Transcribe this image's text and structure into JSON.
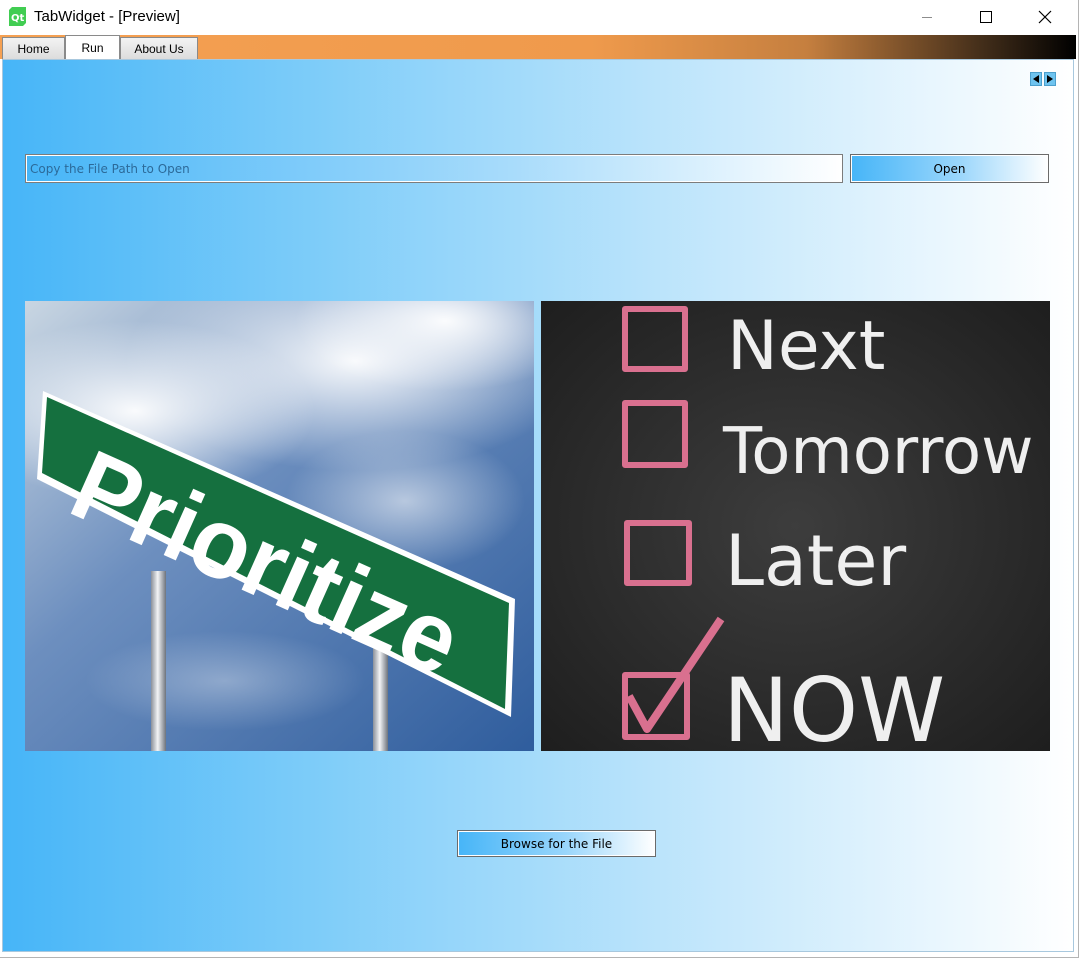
{
  "window": {
    "title": "TabWidget - [Preview]",
    "app_icon": "qt-logo-icon",
    "controls": [
      "minimize-icon",
      "maximize-icon",
      "close-icon"
    ]
  },
  "tabs": [
    {
      "label": "Home",
      "active": false
    },
    {
      "label": "Run",
      "active": true
    },
    {
      "label": "About Us",
      "active": false
    }
  ],
  "tab_scroll": {
    "left_icon": "arrow-left-icon",
    "right_icon": "arrow-right-icon"
  },
  "file_path": {
    "placeholder": "Copy the File Path to Open",
    "value": ""
  },
  "open_button": {
    "label": "Open"
  },
  "images": {
    "left": {
      "sign_text": "Prioritize"
    },
    "right": {
      "items": [
        "Next",
        "Tomorrow",
        "Later",
        "NOW"
      ],
      "checked": "NOW"
    }
  },
  "browse_button": {
    "label": "Browse for the File"
  },
  "colors": {
    "tabbar_start": "#f5a052",
    "tabbar_end": "#000000",
    "content_start": "#46b5f8",
    "content_end": "#ffffff",
    "sign_green": "#15703f",
    "chalk_pink": "#d9708f"
  }
}
